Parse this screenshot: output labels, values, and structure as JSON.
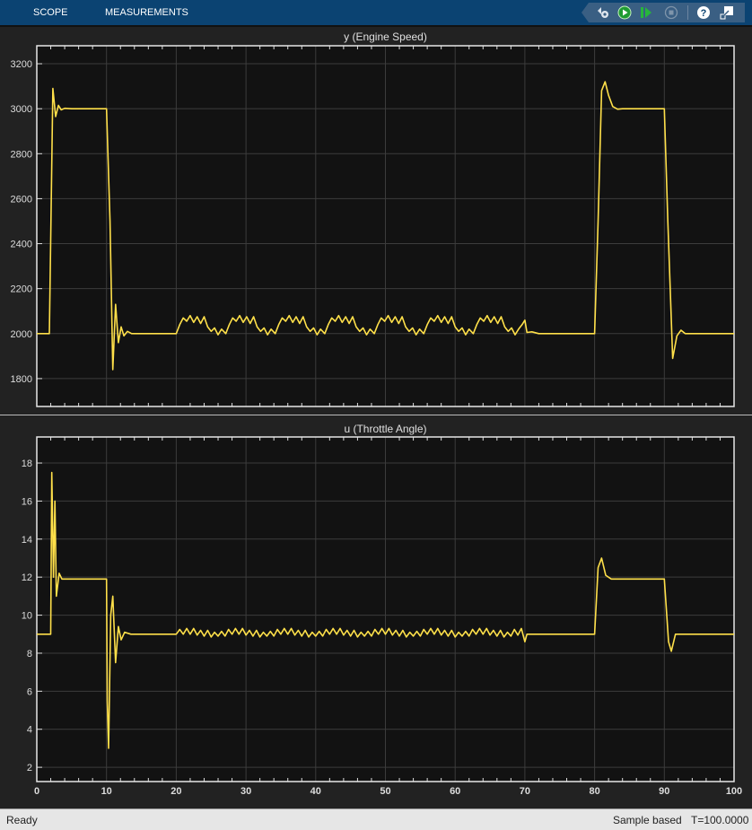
{
  "toolbar": {
    "tabs": [
      "SCOPE",
      "MEASUREMENTS"
    ],
    "icons": [
      "settings-icon",
      "run-icon",
      "step-forward-icon",
      "stop-icon",
      "help-icon",
      "undock-icon"
    ]
  },
  "status": {
    "left": "Ready",
    "sample": "Sample based",
    "time": "T=100.0000"
  },
  "colors": {
    "trace": "#ffe04a",
    "plot_bg": "#121212",
    "grid": "#3c3c3c",
    "toolbar": "#0b4372"
  },
  "chart_data": [
    {
      "type": "line",
      "title": "y (Engine Speed)",
      "xlim": [
        0,
        100
      ],
      "ylim": [
        1676,
        3280
      ],
      "xticks": [
        0,
        10,
        20,
        30,
        40,
        50,
        60,
        70,
        80,
        90,
        100
      ],
      "yticks": [
        1800,
        2000,
        2200,
        2400,
        2600,
        2800,
        3000,
        3200
      ],
      "grid": true,
      "series": [
        {
          "name": "y",
          "points": [
            [
              0,
              2000
            ],
            [
              1.8,
              2000
            ],
            [
              2.3,
              3090
            ],
            [
              2.7,
              2965
            ],
            [
              3.1,
              3015
            ],
            [
              3.5,
              2995
            ],
            [
              4,
              3002
            ],
            [
              5,
              3000
            ],
            [
              10,
              3000
            ],
            [
              10.5,
              2500
            ],
            [
              10.9,
              1840
            ],
            [
              11.3,
              2130
            ],
            [
              11.7,
              1960
            ],
            [
              12.1,
              2030
            ],
            [
              12.5,
              1990
            ],
            [
              13,
              2010
            ],
            [
              13.6,
              2000
            ],
            [
              20,
              2000
            ],
            [
              20.5,
              2040
            ],
            [
              21,
              2070
            ],
            [
              21.5,
              2055
            ],
            [
              22,
              2080
            ],
            [
              22.5,
              2050
            ],
            [
              23,
              2075
            ],
            [
              23.5,
              2045
            ],
            [
              24,
              2075
            ],
            [
              24.5,
              2030
            ],
            [
              25,
              2010
            ],
            [
              25.5,
              2025
            ],
            [
              26,
              1995
            ],
            [
              26.5,
              2020
            ],
            [
              27.1,
              2000
            ],
            [
              27.6,
              2040
            ],
            [
              28.1,
              2070
            ],
            [
              28.6,
              2055
            ],
            [
              29.1,
              2080
            ],
            [
              29.6,
              2050
            ],
            [
              30.1,
              2075
            ],
            [
              30.6,
              2045
            ],
            [
              31.1,
              2075
            ],
            [
              31.6,
              2030
            ],
            [
              32.1,
              2010
            ],
            [
              32.6,
              2025
            ],
            [
              33.1,
              1995
            ],
            [
              33.6,
              2020
            ],
            [
              34.2,
              2000
            ],
            [
              34.7,
              2040
            ],
            [
              35.2,
              2070
            ],
            [
              35.7,
              2055
            ],
            [
              36.2,
              2080
            ],
            [
              36.7,
              2050
            ],
            [
              37.2,
              2075
            ],
            [
              37.7,
              2045
            ],
            [
              38.2,
              2075
            ],
            [
              38.7,
              2030
            ],
            [
              39.2,
              2010
            ],
            [
              39.7,
              2025
            ],
            [
              40.2,
              1995
            ],
            [
              40.7,
              2020
            ],
            [
              41.3,
              2000
            ],
            [
              41.8,
              2040
            ],
            [
              42.3,
              2070
            ],
            [
              42.8,
              2055
            ],
            [
              43.3,
              2080
            ],
            [
              43.8,
              2050
            ],
            [
              44.3,
              2075
            ],
            [
              44.8,
              2045
            ],
            [
              45.3,
              2075
            ],
            [
              45.8,
              2030
            ],
            [
              46.3,
              2010
            ],
            [
              46.8,
              2025
            ],
            [
              47.3,
              1995
            ],
            [
              47.8,
              2020
            ],
            [
              48.4,
              2000
            ],
            [
              48.9,
              2040
            ],
            [
              49.4,
              2070
            ],
            [
              49.9,
              2055
            ],
            [
              50.4,
              2080
            ],
            [
              50.9,
              2050
            ],
            [
              51.4,
              2075
            ],
            [
              51.9,
              2045
            ],
            [
              52.4,
              2075
            ],
            [
              52.9,
              2030
            ],
            [
              53.4,
              2010
            ],
            [
              53.9,
              2025
            ],
            [
              54.4,
              1995
            ],
            [
              54.9,
              2020
            ],
            [
              55.5,
              2000
            ],
            [
              56,
              2040
            ],
            [
              56.5,
              2070
            ],
            [
              57,
              2055
            ],
            [
              57.5,
              2080
            ],
            [
              58,
              2050
            ],
            [
              58.5,
              2075
            ],
            [
              59,
              2045
            ],
            [
              59.5,
              2075
            ],
            [
              60,
              2030
            ],
            [
              60.5,
              2010
            ],
            [
              61,
              2025
            ],
            [
              61.5,
              1995
            ],
            [
              62,
              2020
            ],
            [
              62.6,
              2000
            ],
            [
              63.1,
              2040
            ],
            [
              63.6,
              2070
            ],
            [
              64.1,
              2055
            ],
            [
              64.6,
              2080
            ],
            [
              65.1,
              2050
            ],
            [
              65.6,
              2075
            ],
            [
              66.1,
              2045
            ],
            [
              66.6,
              2075
            ],
            [
              67.1,
              2030
            ],
            [
              67.6,
              2010
            ],
            [
              68.1,
              2025
            ],
            [
              68.6,
              1995
            ],
            [
              69.1,
              2020
            ],
            [
              69.6,
              2040
            ],
            [
              70,
              2060
            ],
            [
              70.3,
              2005
            ],
            [
              71,
              2008
            ],
            [
              72,
              2000
            ],
            [
              80,
              2000
            ],
            [
              80.5,
              2500
            ],
            [
              81,
              3080
            ],
            [
              81.5,
              3120
            ],
            [
              82,
              3060
            ],
            [
              82.6,
              3010
            ],
            [
              83.3,
              2998
            ],
            [
              84,
              3000
            ],
            [
              90,
              3000
            ],
            [
              90.5,
              2500
            ],
            [
              91.2,
              1890
            ],
            [
              91.8,
              1990
            ],
            [
              92.4,
              2015
            ],
            [
              93,
              2000
            ],
            [
              100,
              2000
            ]
          ]
        }
      ]
    },
    {
      "type": "line",
      "title": "u (Throttle Angle)",
      "xlim": [
        0,
        100
      ],
      "ylim": [
        1.25,
        19.37
      ],
      "xticks": [
        0,
        10,
        20,
        30,
        40,
        50,
        60,
        70,
        80,
        90,
        100
      ],
      "yticks": [
        2,
        4,
        6,
        8,
        10,
        12,
        14,
        16,
        18
      ],
      "grid": true,
      "series": [
        {
          "name": "u",
          "points": [
            [
              0,
              9
            ],
            [
              2,
              9
            ],
            [
              2.15,
              17.5
            ],
            [
              2.4,
              12
            ],
            [
              2.6,
              16
            ],
            [
              2.8,
              11
            ],
            [
              3.2,
              12.2
            ],
            [
              3.6,
              11.9
            ],
            [
              10,
              11.9
            ],
            [
              10.1,
              5.5
            ],
            [
              10.3,
              3
            ],
            [
              10.6,
              10
            ],
            [
              10.9,
              11
            ],
            [
              11.3,
              7.5
            ],
            [
              11.7,
              9.4
            ],
            [
              12.1,
              8.7
            ],
            [
              12.6,
              9.1
            ],
            [
              13.5,
              9
            ],
            [
              20,
              9
            ],
            [
              20.5,
              9.25
            ],
            [
              21,
              9.0
            ],
            [
              21.5,
              9.3
            ],
            [
              22,
              9.0
            ],
            [
              22.5,
              9.3
            ],
            [
              23,
              8.95
            ],
            [
              23.5,
              9.2
            ],
            [
              24,
              8.9
            ],
            [
              24.5,
              9.2
            ],
            [
              25,
              8.85
            ],
            [
              25.5,
              9.1
            ],
            [
              26,
              8.9
            ],
            [
              26.5,
              9.15
            ],
            [
              27,
              8.9
            ],
            [
              27.5,
              9.25
            ],
            [
              28,
              9.0
            ],
            [
              28.5,
              9.3
            ],
            [
              29,
              9.0
            ],
            [
              29.5,
              9.3
            ],
            [
              30,
              8.95
            ],
            [
              30.5,
              9.2
            ],
            [
              31,
              8.9
            ],
            [
              31.5,
              9.2
            ],
            [
              32,
              8.85
            ],
            [
              32.5,
              9.1
            ],
            [
              33,
              8.9
            ],
            [
              33.5,
              9.15
            ],
            [
              34,
              8.9
            ],
            [
              34.5,
              9.25
            ],
            [
              35,
              9.0
            ],
            [
              35.5,
              9.3
            ],
            [
              36,
              9.0
            ],
            [
              36.5,
              9.3
            ],
            [
              37,
              8.95
            ],
            [
              37.5,
              9.2
            ],
            [
              38,
              8.9
            ],
            [
              38.5,
              9.2
            ],
            [
              39,
              8.85
            ],
            [
              39.5,
              9.1
            ],
            [
              40,
              8.9
            ],
            [
              40.5,
              9.15
            ],
            [
              41,
              8.9
            ],
            [
              41.5,
              9.25
            ],
            [
              42,
              9.0
            ],
            [
              42.5,
              9.3
            ],
            [
              43,
              9.0
            ],
            [
              43.5,
              9.3
            ],
            [
              44,
              8.95
            ],
            [
              44.5,
              9.2
            ],
            [
              45,
              8.9
            ],
            [
              45.5,
              9.2
            ],
            [
              46,
              8.85
            ],
            [
              46.5,
              9.1
            ],
            [
              47,
              8.9
            ],
            [
              47.5,
              9.15
            ],
            [
              48,
              8.9
            ],
            [
              48.5,
              9.25
            ],
            [
              49,
              9.0
            ],
            [
              49.5,
              9.3
            ],
            [
              50,
              9.0
            ],
            [
              50.5,
              9.3
            ],
            [
              51,
              8.95
            ],
            [
              51.5,
              9.2
            ],
            [
              52,
              8.9
            ],
            [
              52.5,
              9.2
            ],
            [
              53,
              8.85
            ],
            [
              53.5,
              9.1
            ],
            [
              54,
              8.9
            ],
            [
              54.5,
              9.15
            ],
            [
              55,
              8.9
            ],
            [
              55.5,
              9.25
            ],
            [
              56,
              9.0
            ],
            [
              56.5,
              9.3
            ],
            [
              57,
              9.0
            ],
            [
              57.5,
              9.3
            ],
            [
              58,
              8.95
            ],
            [
              58.5,
              9.2
            ],
            [
              59,
              8.9
            ],
            [
              59.5,
              9.2
            ],
            [
              60,
              8.85
            ],
            [
              60.5,
              9.1
            ],
            [
              61,
              8.9
            ],
            [
              61.5,
              9.15
            ],
            [
              62,
              8.9
            ],
            [
              62.5,
              9.25
            ],
            [
              63,
              9.0
            ],
            [
              63.5,
              9.3
            ],
            [
              64,
              9.0
            ],
            [
              64.5,
              9.3
            ],
            [
              65,
              8.95
            ],
            [
              65.5,
              9.2
            ],
            [
              66,
              8.9
            ],
            [
              66.5,
              9.2
            ],
            [
              67,
              8.85
            ],
            [
              67.5,
              9.1
            ],
            [
              68,
              8.9
            ],
            [
              68.5,
              9.25
            ],
            [
              69,
              8.95
            ],
            [
              69.5,
              9.3
            ],
            [
              70,
              8.6
            ],
            [
              70.3,
              9
            ],
            [
              80,
              9
            ],
            [
              80.5,
              12.5
            ],
            [
              81,
              13.0
            ],
            [
              81.6,
              12.1
            ],
            [
              82.4,
              11.9
            ],
            [
              90,
              11.9
            ],
            [
              90.6,
              8.6
            ],
            [
              91,
              8.1
            ],
            [
              91.6,
              9.0
            ],
            [
              92.4,
              9
            ],
            [
              100,
              9
            ]
          ]
        }
      ]
    }
  ]
}
